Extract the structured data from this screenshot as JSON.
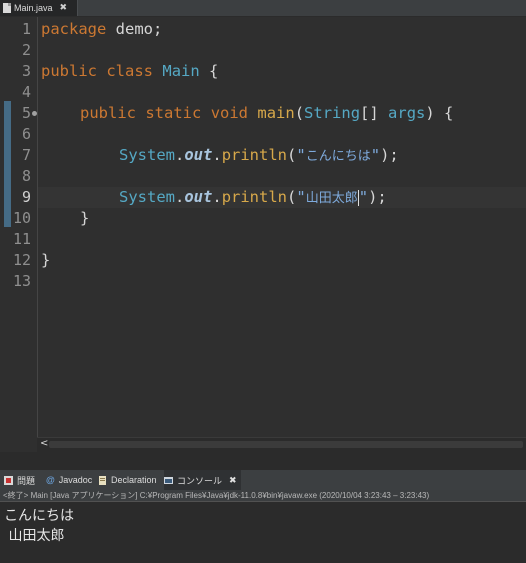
{
  "editor_tab": {
    "label": "Main.java",
    "close": "✖"
  },
  "line_numbers": [
    "1",
    "2",
    "3",
    "4",
    "5",
    "6",
    "7",
    "8",
    "9",
    "10",
    "11",
    "12",
    "13"
  ],
  "code": {
    "l1": {
      "kw": "package",
      "rest": " demo;"
    },
    "l3": {
      "kw1": "public",
      "kw2": "class",
      "cls": "Main",
      "brace": " {"
    },
    "l5": {
      "kw1": "public",
      "kw2": "static",
      "kw3": "void",
      "mth": "main",
      "open": "(",
      "cls": "String",
      "arr": "[] ",
      "arg": "args",
      "close": ") {"
    },
    "l7": {
      "cls": "System",
      "dot1": ".",
      "fld": "out",
      "dot2": ".",
      "mth": "println",
      "open": "(",
      "q1": "\"",
      "jp": "こんにちは",
      "q2": "\"",
      "close": ");"
    },
    "l9": {
      "cls": "System",
      "dot1": ".",
      "fld": "out",
      "dot2": ".",
      "mth": "println",
      "open": "(",
      "q1": "\"",
      "jp": "山田太郎",
      "q2": "\"",
      "close": ");"
    },
    "l10": {
      "brace": "}"
    },
    "l12": {
      "brace": "}"
    }
  },
  "bottom_tabs": [
    {
      "label": "問題",
      "icon": "problems-icon"
    },
    {
      "label": "Javadoc",
      "icon": "javadoc-icon"
    },
    {
      "label": "Declaration",
      "icon": "declaration-icon"
    },
    {
      "label": "コンソール",
      "icon": "console-icon"
    }
  ],
  "console_close": "✖",
  "console_status": "<終了> Main [Java アプリケーション] C:¥Program Files¥Java¥jdk-11.0.8¥bin¥javaw.exe  (2020/10/04 3:23:43 – 3:23:43)",
  "console_output": [
    "こんにちは",
    " 山田太郎"
  ],
  "scroll_arrow": "<",
  "colors": {
    "keyword": "#cc7832",
    "class": "#55a8c4",
    "method": "#d7a84a",
    "string": "#7eaadc"
  }
}
